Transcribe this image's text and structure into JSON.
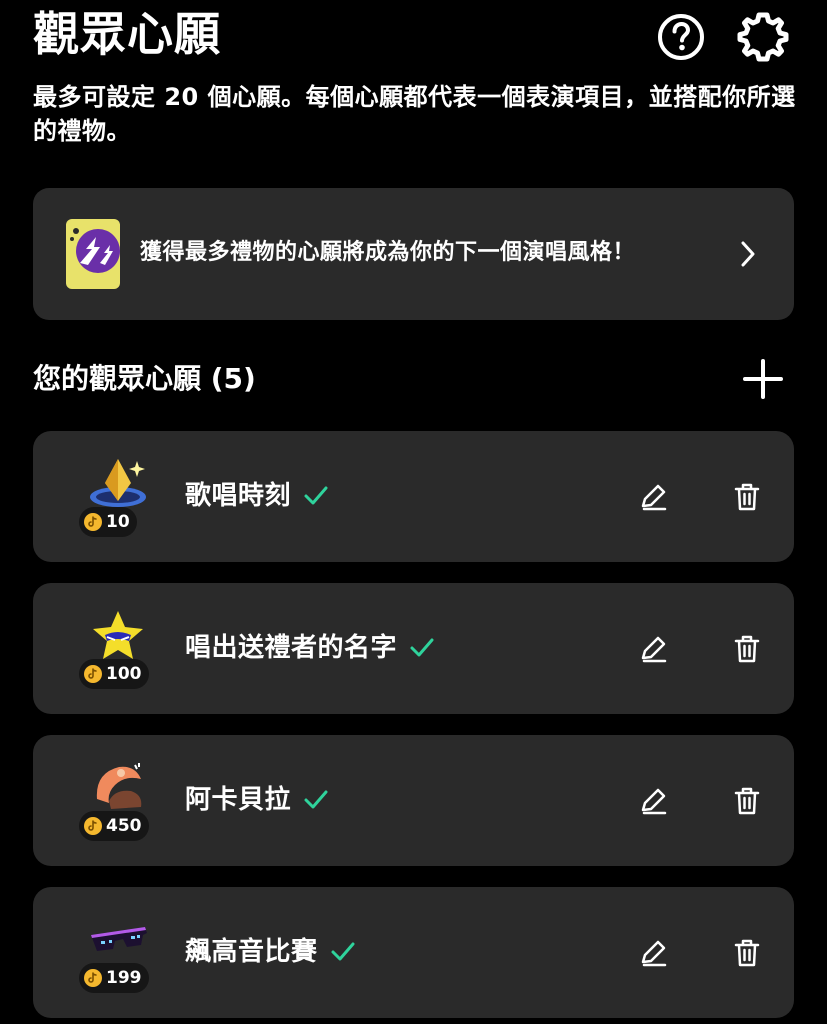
{
  "header": {
    "title": "觀眾心願",
    "help_icon": "question-circle-icon",
    "settings_icon": "gear-icon"
  },
  "description": "最多可設定 20 個心願。每個心願都代表一個表演項目，並搭配你所選的禮物。",
  "banner": {
    "text": "獲得最多禮物的心願將成為你的下一個演唱風格！",
    "chevron_icon": "chevron-right-icon"
  },
  "section": {
    "title": "您的觀眾心願 (5)",
    "add_icon": "plus-icon"
  },
  "wishes": [
    {
      "name": "歌唱時刻",
      "coins": "10",
      "gift_icon": "gold-crystal-gift-icon"
    },
    {
      "name": "唱出送禮者的名字",
      "coins": "100",
      "gift_icon": "yellow-star-gift-icon"
    },
    {
      "name": "阿卡貝拉",
      "coins": "450",
      "gift_icon": "hat-gift-icon"
    },
    {
      "name": "飆高音比賽",
      "coins": "199",
      "gift_icon": "pixel-sunglasses-gift-icon"
    }
  ],
  "colors": {
    "background": "#000000",
    "card": "#2a2a2a",
    "check": "#2fd39c",
    "coin": "#f5b82e",
    "text": "#ffffff"
  }
}
